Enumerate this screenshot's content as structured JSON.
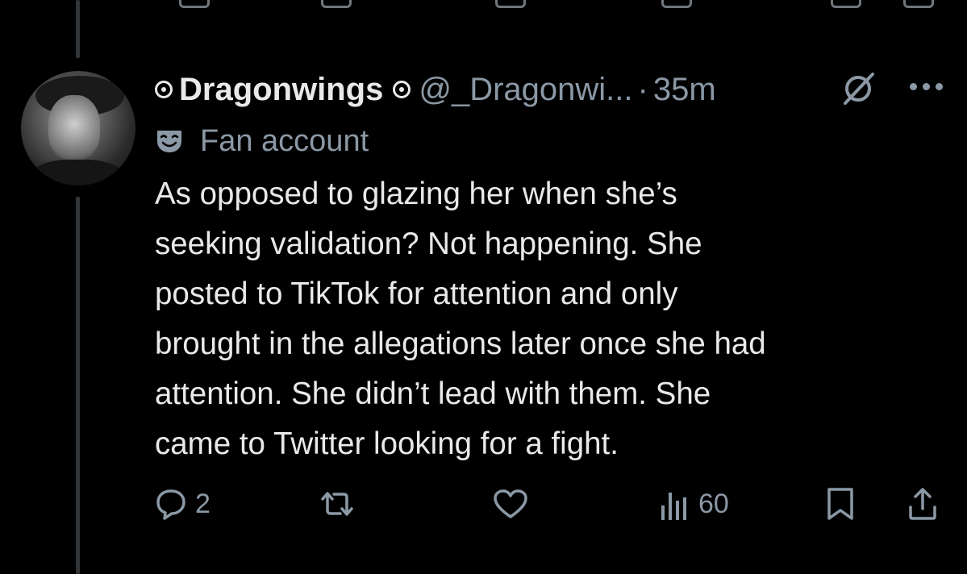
{
  "tweet": {
    "display_name": "Dragonwings",
    "handle": "@_Dragonwi...",
    "separator": "·",
    "time": "35m",
    "label": "Fan account",
    "body_lines": [
      "As opposed to glazing her when she’s",
      "seeking validation? Not happening.  She",
      "posted to TikTok for attention and only",
      "brought in the allegations later once she had",
      "attention. She didn’t lead with them. She",
      "came to Twitter looking for a fight."
    ]
  },
  "actions": {
    "reply_count": "2",
    "retweet_count": "",
    "like_count": "",
    "views_count": "60"
  },
  "icons": {
    "name_prefix": "ring-icon",
    "name_suffix": "ring-icon",
    "label_icon": "theater-mask-icon",
    "header_action": "grok-slash-icon",
    "more": "more-dots-icon",
    "reply": "reply-icon",
    "retweet": "retweet-icon",
    "like": "heart-icon",
    "views": "views-bar-chart-icon",
    "bookmark": "bookmark-icon",
    "share": "share-icon"
  },
  "colors": {
    "background": "#000000",
    "primary_text": "#e7e9ea",
    "secondary_text": "#8b98a5",
    "thread_line": "#333639"
  }
}
